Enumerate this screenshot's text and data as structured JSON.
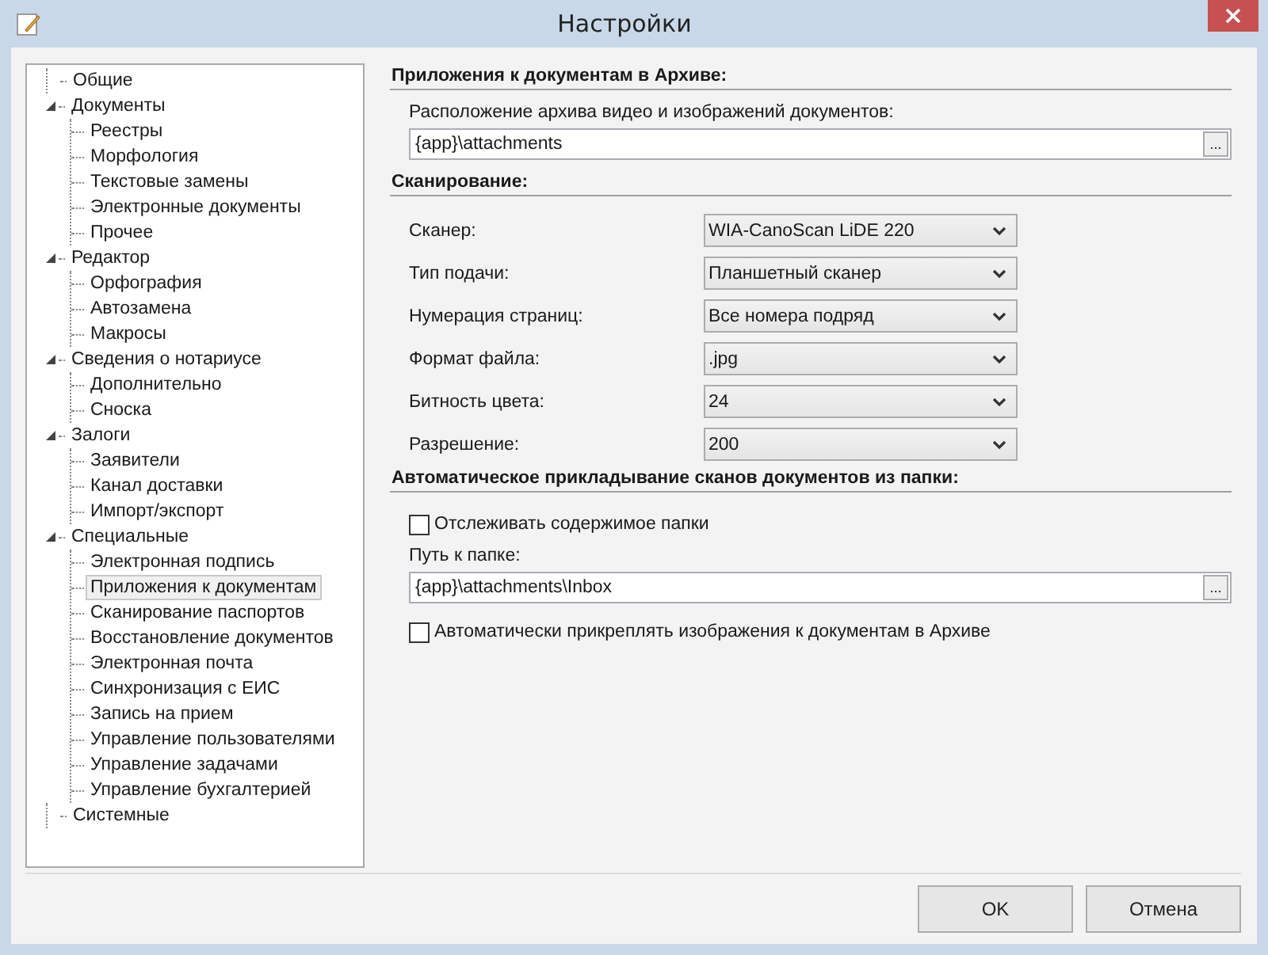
{
  "window": {
    "title": "Настройки"
  },
  "tree": [
    {
      "label": "Общие",
      "selected": false,
      "expanded": false
    },
    {
      "label": "Документы",
      "selected": false,
      "expanded": true,
      "children": [
        {
          "label": "Реестры",
          "selected": false
        },
        {
          "label": "Морфология",
          "selected": false
        },
        {
          "label": "Текстовые замены",
          "selected": false
        },
        {
          "label": "Электронные документы",
          "selected": false
        },
        {
          "label": "Прочее",
          "selected": false
        }
      ]
    },
    {
      "label": "Редактор",
      "selected": false,
      "expanded": true,
      "children": [
        {
          "label": "Орфография",
          "selected": false
        },
        {
          "label": "Автозамена",
          "selected": false
        },
        {
          "label": "Макросы",
          "selected": false
        }
      ]
    },
    {
      "label": "Сведения о нотариусе",
      "selected": false,
      "expanded": true,
      "children": [
        {
          "label": "Дополнительно",
          "selected": false
        },
        {
          "label": "Сноска",
          "selected": false
        }
      ]
    },
    {
      "label": "Залоги",
      "selected": false,
      "expanded": true,
      "children": [
        {
          "label": "Заявители",
          "selected": false
        },
        {
          "label": "Канал доставки",
          "selected": false
        },
        {
          "label": "Импорт/экспорт",
          "selected": false
        }
      ]
    },
    {
      "label": "Специальные",
      "selected": false,
      "expanded": true,
      "children": [
        {
          "label": "Электронная подпись",
          "selected": false
        },
        {
          "label": "Приложения к документам",
          "selected": true
        },
        {
          "label": "Сканирование паспортов",
          "selected": false
        },
        {
          "label": "Восстановление документов",
          "selected": false
        },
        {
          "label": "Электронная почта",
          "selected": false
        },
        {
          "label": "Синхронизация с ЕИС",
          "selected": false
        },
        {
          "label": "Запись на прием",
          "selected": false
        },
        {
          "label": "Управление пользователями",
          "selected": false
        },
        {
          "label": "Управление задачами",
          "selected": false
        },
        {
          "label": "Управление бухгалтерией",
          "selected": false
        }
      ]
    },
    {
      "label": "Системные",
      "selected": false,
      "expanded": false
    }
  ],
  "sections": [
    {
      "title": "Приложения к документам в Архиве:",
      "items": [
        {
          "kind": "label",
          "text": "Расположение архива видео и изображений документов:"
        },
        {
          "kind": "path",
          "value": "{app}\\attachments",
          "button": "..."
        }
      ]
    },
    {
      "title": "Сканирование:",
      "items": [
        {
          "kind": "dropdown",
          "label": "Сканер:",
          "value": "WIA-CanoScan LiDE 220"
        },
        {
          "kind": "dropdown",
          "label": "Тип подачи:",
          "value": "Планшетный сканер"
        },
        {
          "kind": "dropdown",
          "label": "Нумерация страниц:",
          "value": "Все номера подряд"
        },
        {
          "kind": "dropdown",
          "label": "Формат файла:",
          "value": ".jpg"
        },
        {
          "kind": "dropdown",
          "label": "Битность цвета:",
          "value": "24"
        },
        {
          "kind": "dropdown",
          "label": "Разрешение:",
          "value": "200"
        }
      ]
    },
    {
      "title": "Автоматическое прикладывание сканов документов из папки:",
      "items": [
        {
          "kind": "checkbox",
          "label": "Отслеживать содержимое папки",
          "checked": false
        },
        {
          "kind": "label",
          "text": "Путь к папке:"
        },
        {
          "kind": "path",
          "value": "{app}\\attachments\\Inbox",
          "button": "..."
        },
        {
          "kind": "checkbox",
          "label": "Автоматически прикреплять изображения к документам в Архиве",
          "checked": false
        }
      ]
    }
  ],
  "buttons": [
    "OK",
    "Отмена"
  ]
}
